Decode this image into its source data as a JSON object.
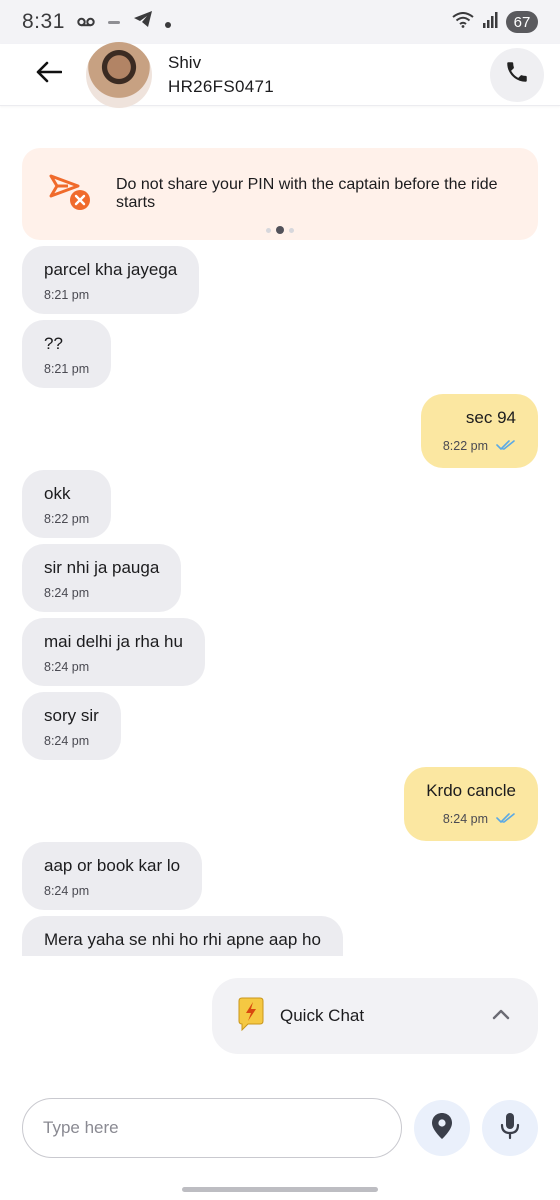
{
  "status_bar": {
    "time": "8:31",
    "battery": "67",
    "icons": [
      "voicemail-icon",
      "telegram-icon",
      "notification-dot-icon",
      "wifi-icon",
      "signal-icon",
      "battery-icon"
    ]
  },
  "header": {
    "back_icon": "arrow-left-icon",
    "name": "Shiv",
    "plate": "HR26FS0471",
    "call_icon": "phone-icon"
  },
  "banner": {
    "text": "Do not share your PIN with the captain before the ride starts",
    "icon": "pin-warning-icon",
    "page_dots": 3,
    "active_dot": 2
  },
  "messages": [
    {
      "direction": "in",
      "text": "parcel kha jayega",
      "time": "8:21 pm"
    },
    {
      "direction": "in",
      "text": "??",
      "time": "8:21 pm"
    },
    {
      "direction": "out",
      "text": "sec 94",
      "time": "8:22 pm",
      "read": true
    },
    {
      "direction": "in",
      "text": "okk",
      "time": "8:22 pm"
    },
    {
      "direction": "in",
      "text": "sir nhi ja pauga",
      "time": "8:24 pm"
    },
    {
      "direction": "in",
      "text": "mai delhi ja rha hu",
      "time": "8:24 pm"
    },
    {
      "direction": "in",
      "text": "sory sir",
      "time": "8:24 pm"
    },
    {
      "direction": "out",
      "text": "Krdo cancle",
      "time": "8:24 pm",
      "read": true
    },
    {
      "direction": "in",
      "text": "aap or book kar lo",
      "time": "8:24 pm"
    },
    {
      "direction": "in",
      "text": "Mera yaha se nhi ho rhi apne aap ho",
      "time": ""
    }
  ],
  "quick_chat": {
    "label": "Quick Chat",
    "icon": "lightning-chat-icon",
    "chevron": "chevron-up-icon"
  },
  "composer": {
    "placeholder": "Type here",
    "location_icon": "location-pin-icon",
    "mic_icon": "microphone-icon"
  },
  "colors": {
    "outgoing_bubble": "#fbe7a1",
    "incoming_bubble": "#ececf0",
    "banner_bg": "#fff1ea",
    "accent_orange": "#f06b2c",
    "read_tick": "#5aa9e6"
  }
}
